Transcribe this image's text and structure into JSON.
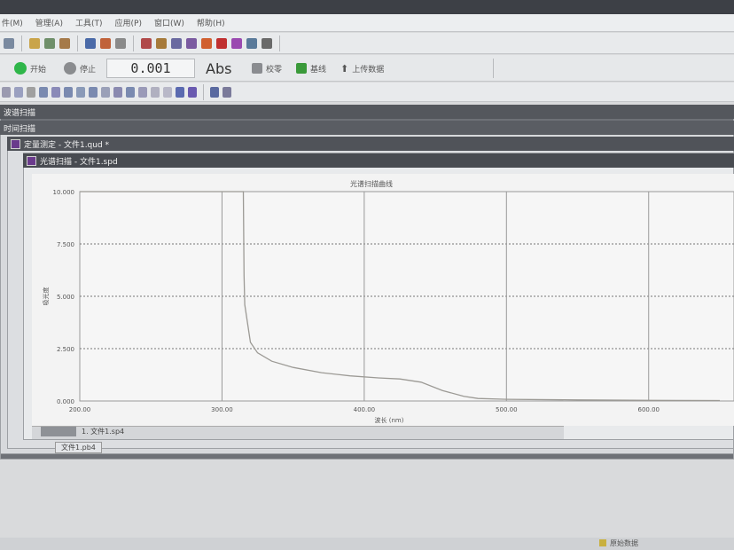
{
  "menu": {
    "items": [
      "件(M)",
      "管理(A)",
      "工具(T)",
      "应用(P)",
      "窗口(W)",
      "帮助(H)"
    ]
  },
  "toolbar2": {
    "start_label": "开始",
    "stop_label": "停止",
    "readout_value": "0.001",
    "unit": "Abs",
    "zero_label": "校零",
    "baseline_label": "基线",
    "upload_label": "上传数据"
  },
  "windows": {
    "outer_title": "波谱扫描",
    "mid_title": "时间扫描",
    "doc1_title": "定量测定 - 文件1.qud *",
    "doc2_title": "光谱扫描 - 文件1.spd"
  },
  "tabs": {
    "tab1": "1. 文件1.sp4",
    "tab2": "文件1.pb4"
  },
  "status": {
    "right_label": "原始数据"
  },
  "colors": {
    "titlebar": "#4b4e55",
    "plot_bg": "#f6f6f6",
    "curve": "#9c9a95",
    "start_green": "#2fb64a",
    "stop_gray": "#8a8c8f"
  },
  "chart_data": {
    "type": "line",
    "title": "光谱扫描曲线",
    "xlabel": "波长 (nm)",
    "ylabel": "吸光度",
    "xlim": [
      200,
      660
    ],
    "ylim": [
      0,
      10
    ],
    "x_ticks": [
      "200.00",
      "300.00",
      "400.00",
      "500.00",
      "600.00"
    ],
    "y_ticks": [
      "0.000",
      "2.500",
      "5.000",
      "7.500",
      "10.000"
    ],
    "grid": true,
    "series": [
      {
        "x": [
          200,
          315,
          315.5,
          316,
          320,
          325,
          335,
          350,
          370,
          390,
          410,
          425,
          440,
          455,
          470,
          480,
          500,
          550,
          600,
          650
        ],
        "y": [
          10,
          10,
          6.0,
          4.6,
          2.8,
          2.3,
          1.9,
          1.6,
          1.35,
          1.2,
          1.1,
          1.05,
          0.9,
          0.5,
          0.22,
          0.12,
          0.08,
          0.05,
          0.03,
          0.02
        ]
      }
    ]
  }
}
